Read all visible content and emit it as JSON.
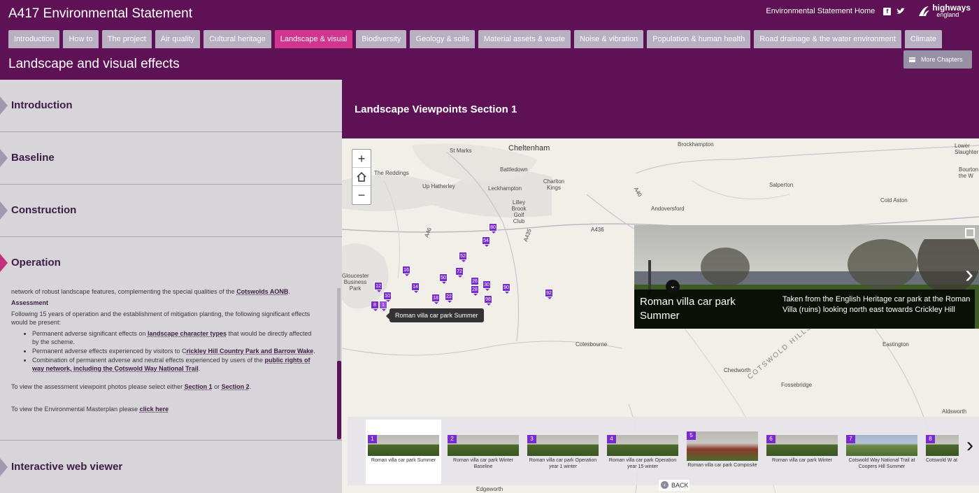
{
  "header": {
    "title": "A417 Environmental Statement",
    "home_link": "Environmental Statement Home",
    "logo_line1": "highways",
    "logo_line2": "england",
    "page_heading": "Landscape and visual effects",
    "more_chapters": "More Chapters"
  },
  "tabs": [
    {
      "label": "Introduction"
    },
    {
      "label": "How to"
    },
    {
      "label": "The project"
    },
    {
      "label": "Air quality"
    },
    {
      "label": "Cultural heritage"
    },
    {
      "label": "Landscape & visual"
    },
    {
      "label": "Biodiversity"
    },
    {
      "label": "Geology & soils"
    },
    {
      "label": "Material assets & waste"
    },
    {
      "label": "Noise & vibration"
    },
    {
      "label": "Population & human health"
    },
    {
      "label": "Road drainage & the water environment"
    },
    {
      "label": "Climate"
    }
  ],
  "active_tab": "Landscape & visual",
  "accordion": {
    "introduction": "Introduction",
    "baseline": "Baseline",
    "construction": "Construction",
    "operation": "Operation",
    "interactive": "Interactive web viewer"
  },
  "operation": {
    "intro_text": "network of robust landscape features, complementing the special qualities of the ",
    "intro_link": "Cotswolds AONB",
    "assessment_heading": "Assessment",
    "assessment_text": "Following 15 years of operation and the establishment of mitigation planting, the following significant effects would be present:",
    "b1_pre": "Permanent adverse significant effects on ",
    "b1_link": "landscape character types",
    "b1_post": " that would be directly affected by the scheme.",
    "b2_pre": "Permanent adverse effects experienced by visitors to C",
    "b2_link": "rickley Hill Country Park and Barrow Wake",
    "b2_post": ".",
    "b3_pre": "Combination of permanent adverse and neutral effects experienced by users of the ",
    "b3_link": "public rights of way network, including the Cotswold Way National Trail",
    "b3_post": ".",
    "view_pre": "To view the assessment viewpoint photos please select either ",
    "view_link1": "Section 1",
    "view_mid": " or ",
    "view_link2": "Section 2",
    "view_post": ".",
    "master_pre": "To view the Environmental Masterplan please ",
    "master_link": "click here"
  },
  "map": {
    "title": "Landscape Viewpoints Section 1",
    "places": {
      "cheltenham": "Cheltenham",
      "brockhampton": "Brockhampton",
      "st_marks": "St Marks",
      "battledown": "Battledown",
      "the_reddings": "The Reddings",
      "up_hatherley": "Up Hatherley",
      "leckhampton": "Leckhampton",
      "charlton_kings": "Charlton Kings",
      "salperton": "Salperton",
      "andoversford": "Andoversford",
      "cold_aston": "Cold Aston",
      "lilley_brook": "Lilley Brook Golf Club",
      "gloucester": "Gloucester Business Park",
      "colesbourne": "Colesbourne",
      "chedworth": "Chedworth",
      "fossebridge": "Fossebridge",
      "eastington": "Eastington",
      "aldsworth": "Aldsworth",
      "edgeworth": "Edgeworth",
      "cotswold_hills": "COTSWOLD HILLS",
      "lower_slaughter": "Lower Slaughter",
      "bourton": "Bourton the W",
      "a436": "A436",
      "a40": "A40",
      "a46": "A46",
      "a435": "A435"
    },
    "pins": [
      "80",
      "54",
      "52",
      "16",
      "72",
      "50",
      "26",
      "28",
      "30",
      "90",
      "14",
      "12",
      "18",
      "98",
      "10",
      "92",
      "22",
      "1",
      "8"
    ],
    "tooltip": "Roman villa car park Summer",
    "zoom_in": "+",
    "zoom_out": "−"
  },
  "photo": {
    "title": "Roman villa car park Summer",
    "description": "Taken from the English Heritage car park at the Roman Villa (ruins) looking north east towards Crickley Hill"
  },
  "filmstrip": [
    {
      "num": "1",
      "label": "Roman villa car park Summer"
    },
    {
      "num": "2",
      "label": "Roman villa car park Winter Baseline"
    },
    {
      "num": "3",
      "label": "Roman villa car park Operation year 1 winter"
    },
    {
      "num": "4",
      "label": "Roman villa car park Operation year 15 winter"
    },
    {
      "num": "5",
      "label": "Roman villa car park Composite"
    },
    {
      "num": "6",
      "label": "Roman villa car park Winter"
    },
    {
      "num": "7",
      "label": "Cotswold Way National Trail at Coopers Hill Summer"
    },
    {
      "num": "8",
      "label": "Cotswold W at Coope"
    }
  ],
  "back_label": "BACK"
}
